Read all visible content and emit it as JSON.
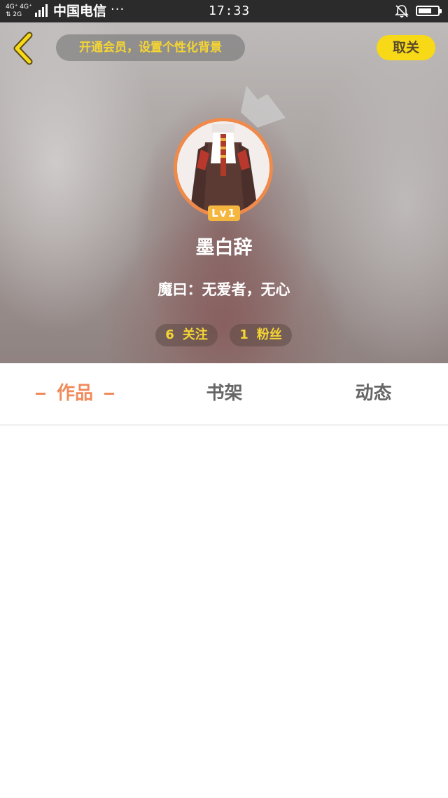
{
  "status_bar": {
    "network_top": "4G⁺ 4G⁺",
    "network_bottom": "⇅ 2G",
    "carrier": "中国电信",
    "more": "···",
    "time": "17:33",
    "battery_level": 0.7,
    "icons": [
      "signal-icon",
      "bell-muted-icon",
      "battery-icon"
    ]
  },
  "header": {
    "back_icon": "chevron-left-icon",
    "vip_banner": "开通会员，设置个性化背景",
    "unfollow_label": "取关",
    "crown_icon": "crown-icon",
    "level": "Lv1",
    "username": "墨白辞",
    "signature": "魔曰：无爱者，无心",
    "stats": {
      "following_count": "6",
      "following_label": "关注",
      "fans_count": "1",
      "fans_label": "粉丝"
    }
  },
  "tabs": [
    {
      "label": "作品",
      "active": true
    },
    {
      "label": "书架",
      "active": false
    },
    {
      "label": "动态",
      "active": false
    }
  ],
  "colors": {
    "accent": "#f08a5b",
    "button_yellow": "#f7d917",
    "stat_text": "#f5d533",
    "status_bar": "#2b2b2b"
  }
}
